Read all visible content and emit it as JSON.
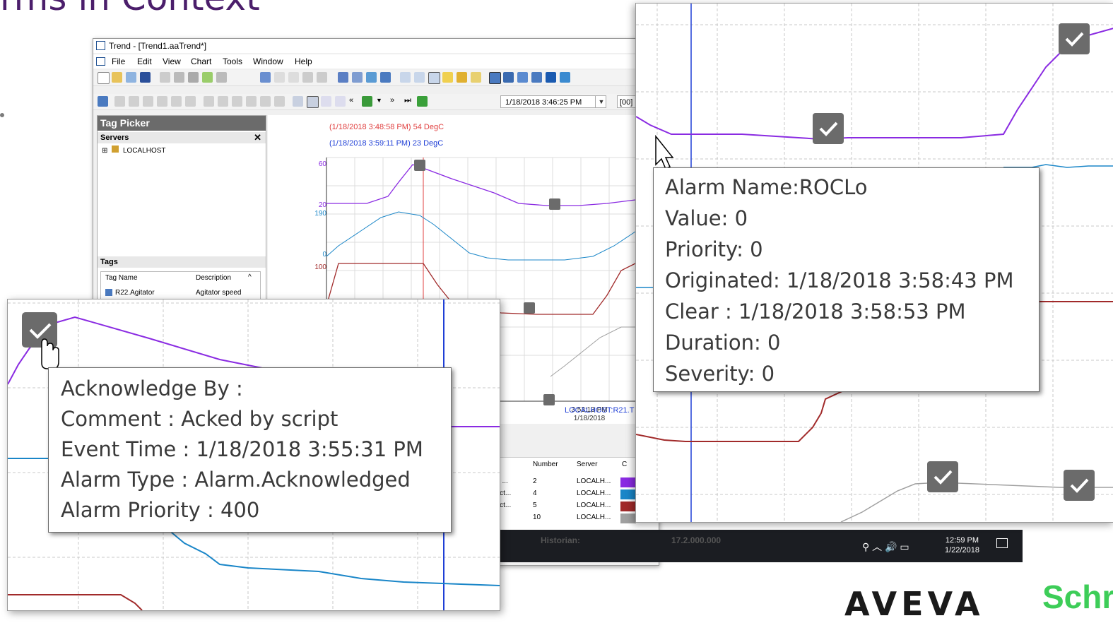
{
  "slide": {
    "title": "rms in Context"
  },
  "window": {
    "title": "Trend - [Trend1.aaTrend*]",
    "menu": [
      "File",
      "Edit",
      "View",
      "Chart",
      "Tools",
      "Window",
      "Help"
    ],
    "toolbar": {
      "date_value": "1/18/2018  3:46:25 PM",
      "offset_value": "[00]"
    }
  },
  "tag_picker": {
    "title": "Tag Picker",
    "servers_label": "Servers",
    "server_node": "LOCALHOST",
    "tags_label": "Tags",
    "columns": [
      "Tag Name",
      "Description"
    ],
    "rows": [
      {
        "name": "R22.Agitator",
        "description": "Agitator speed"
      }
    ]
  },
  "chart": {
    "cursor_label_red": "(1/18/2018 3:48:58 PM) 54 DegC",
    "cursor_label_blue": "(1/18/2018 3:59:11 PM) 23 DegC",
    "y_ticks": {
      "purple": [
        "60",
        "20"
      ],
      "blue": [
        "190",
        "0"
      ],
      "red": [
        "100"
      ]
    },
    "x_tick_time": "3:53:13 PM",
    "x_tick_date": "1/18/2018",
    "footer_server": "LOCALHOST:R21.T"
  },
  "legend": {
    "columns": [
      "Number",
      "Server",
      "C"
    ],
    "rows": [
      {
        "tag": "tor ...",
        "number": "2",
        "server": "LOCALH...",
        "color": "#8a2be2"
      },
      {
        "tag": "eact...",
        "number": "4",
        "server": "LOCALH...",
        "color": "#1a86c8"
      },
      {
        "tag": "eact...",
        "number": "5",
        "server": "LOCALH...",
        "color": "#a12a2a"
      },
      {
        "tag": "2",
        "number": "10",
        "server": "LOCALH...",
        "color": "#a0a0a0"
      }
    ]
  },
  "taskbar": {
    "historian_label": "Historian:",
    "version": "17.2.000.000",
    "time": "12:59 PM",
    "date": "1/22/2018"
  },
  "tooltip_alarm": {
    "lines": [
      "Alarm Name:ROCLo",
      "Value: 0",
      "Priority: 0",
      "Originated: 1/18/2018 3:58:43 PM",
      "Clear : 1/18/2018 3:58:53 PM",
      "Duration: 0",
      "Severity: 0"
    ]
  },
  "tooltip_ack": {
    "lines": [
      "Acknowledge By :",
      "Comment : Acked by script",
      "Event Time : 1/18/2018 3:55:31 PM",
      "Alarm Type : Alarm.Acknowledged",
      "Alarm Priority : 400"
    ]
  },
  "logos": {
    "aveva": "AVEVA",
    "schneider": "Schr"
  },
  "colors": {
    "purple": "#8a2be2",
    "blue": "#1a86c8",
    "red": "#a12a2a",
    "gray": "#a0a0a0",
    "cursor_red": "#e04040",
    "cursor_blue": "#1f3fd6"
  }
}
